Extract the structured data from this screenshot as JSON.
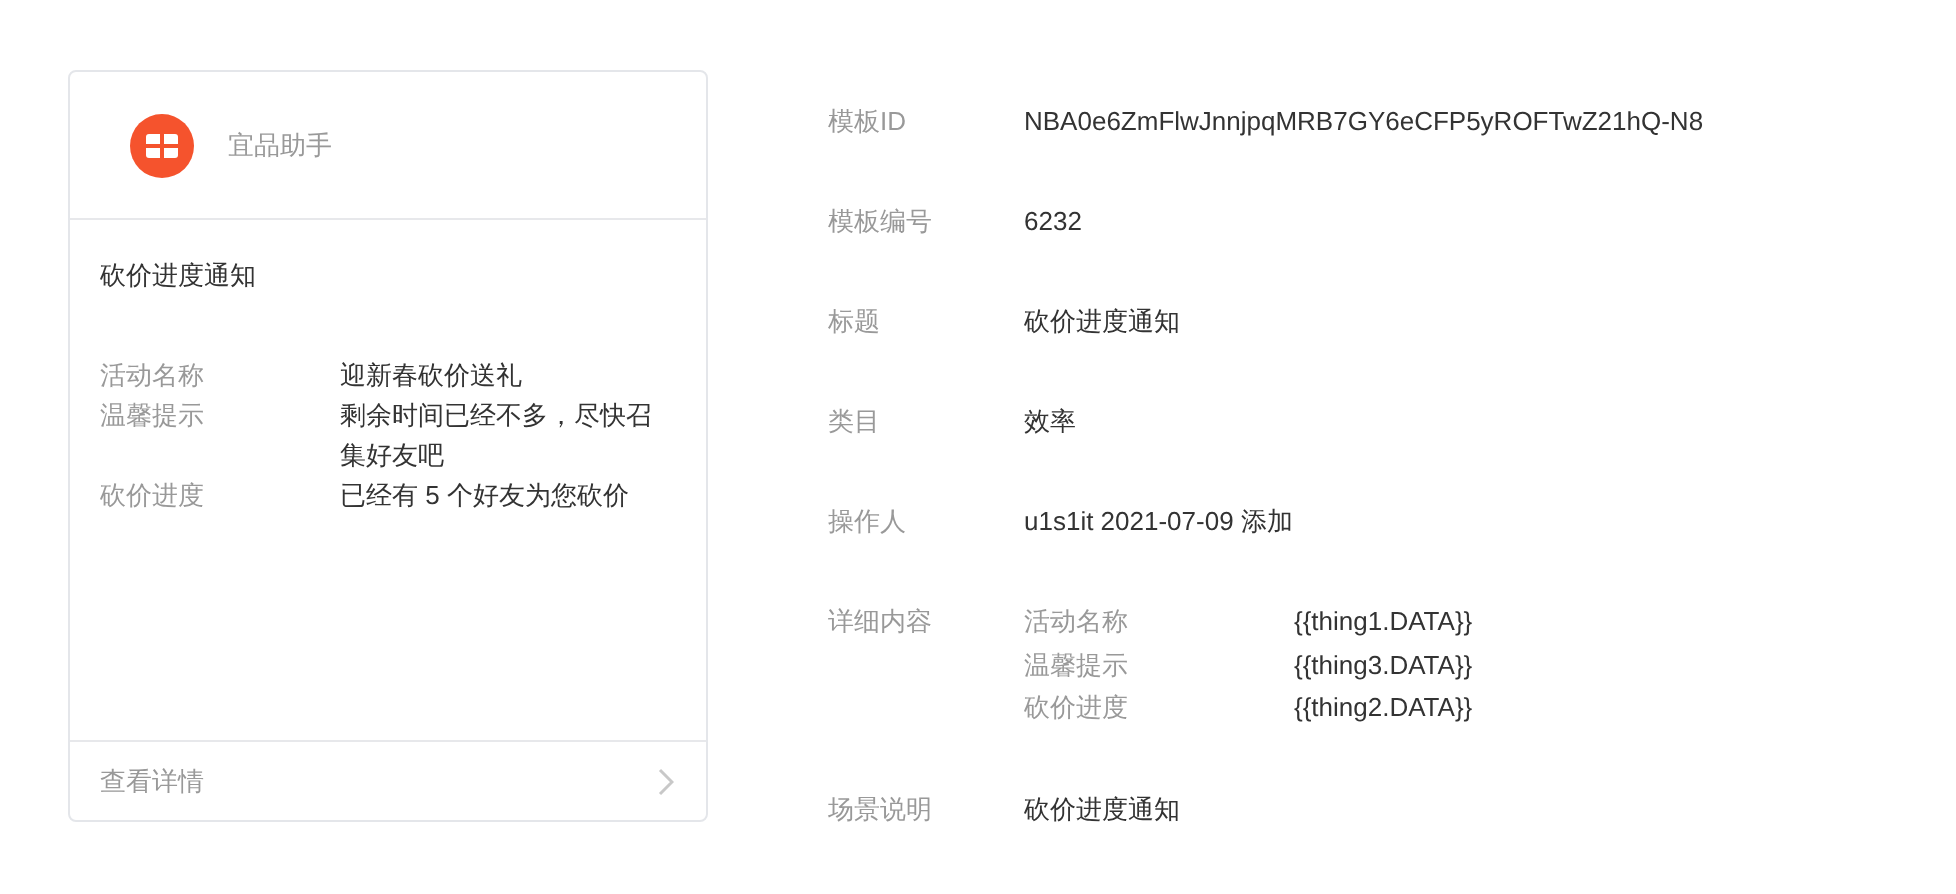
{
  "card": {
    "account": "宜品助手",
    "title": "砍价进度通知",
    "fields": [
      {
        "label": "活动名称",
        "value": "迎新春砍价送礼"
      },
      {
        "label": "温馨提示",
        "value": "剩余时间已经不多，尽快召集好友吧"
      },
      {
        "label": "砍价进度",
        "value": "已经有 5 个好友为您砍价"
      }
    ],
    "footer": "查看详情"
  },
  "details": [
    {
      "kind": "text",
      "label": "模板ID",
      "value": "NBA0e6ZmFlwJnnjpqMRB7GY6eCFP5yROFTwZ21hQ-N8"
    },
    {
      "kind": "text",
      "label": "模板编号",
      "value": "6232"
    },
    {
      "kind": "text",
      "label": "标题",
      "value": "砍价进度通知"
    },
    {
      "kind": "text",
      "label": "类目",
      "value": "效率"
    },
    {
      "kind": "text",
      "label": "操作人",
      "value": "u1s1it 2021-07-09 添加"
    },
    {
      "kind": "fields",
      "label": "详细内容",
      "fields": [
        {
          "name": "活动名称",
          "key": "{{thing1.DATA}}"
        },
        {
          "name": "温馨提示",
          "key": "{{thing3.DATA}}"
        },
        {
          "name": "砍价进度",
          "key": "{{thing2.DATA}}"
        }
      ]
    },
    {
      "kind": "text",
      "label": "场景说明",
      "value": "砍价进度通知"
    }
  ]
}
